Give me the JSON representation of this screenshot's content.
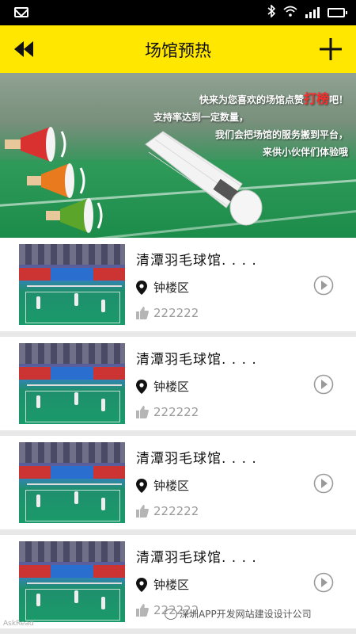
{
  "status_bar": {
    "icons": [
      "mail-icon",
      "bluetooth-icon",
      "wifi-icon",
      "signal-icon",
      "battery-icon"
    ]
  },
  "header": {
    "title": "场馆预热",
    "back_icon": "double-chevron-left-icon",
    "add_icon": "plus-icon",
    "background": "#ffe700"
  },
  "banner": {
    "line1_prefix": "快来为您喜欢的场馆点赞",
    "line1_highlight": "打榜",
    "line1_suffix": "吧！",
    "line2": "支持率达到一定数量，",
    "line3": "我们会把场馆的服务搬到平台，",
    "line4": "来供小伙伴们体验哦",
    "highlight_color": "#ff2b2b"
  },
  "venues": [
    {
      "name": "清潭羽毛球馆. . . .",
      "district": "钟楼区",
      "likes": "222222"
    },
    {
      "name": "清潭羽毛球馆. . . .",
      "district": "钟楼区",
      "likes": "222222"
    },
    {
      "name": "清潭羽毛球馆. . . .",
      "district": "钟楼区",
      "likes": "222222"
    },
    {
      "name": "清潭羽毛球馆. . . .",
      "district": "钟楼区",
      "likes": "222222"
    }
  ],
  "watermark": {
    "text": "深圳APP开发网站建设设计公司",
    "corner": "AskRead"
  }
}
